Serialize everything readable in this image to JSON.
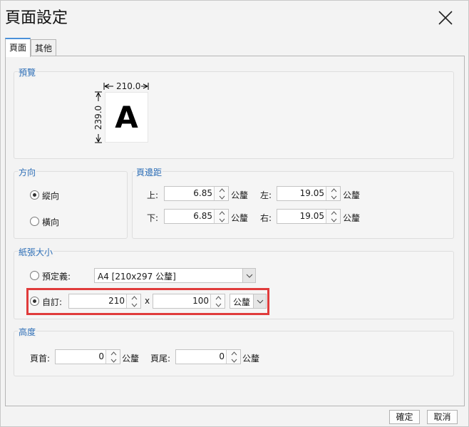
{
  "window": {
    "title": "頁面設定"
  },
  "tabs": [
    {
      "label": "頁面"
    },
    {
      "label": "其他"
    }
  ],
  "preview": {
    "label": "預覽",
    "width": "210.0",
    "height": "239.0",
    "letter": "A"
  },
  "orientation": {
    "label": "方向",
    "portrait": "縱向",
    "landscape": "橫向",
    "selected": "portrait"
  },
  "margins": {
    "label": "頁邊距",
    "top_label": "上:",
    "top": "6.85",
    "left_label": "左:",
    "left": "19.05",
    "bottom_label": "下:",
    "bottom": "6.85",
    "right_label": "右:",
    "right": "19.05",
    "unit": "公釐"
  },
  "paper": {
    "label": "紙張大小",
    "predefined_label": "預定義:",
    "predefined_value": "A4 [210x297 公釐]",
    "custom_label": "自訂:",
    "custom_width": "210",
    "times": "x",
    "custom_height": "100",
    "custom_unit": "公釐",
    "selected": "custom"
  },
  "height_group": {
    "label": "高度",
    "header_label": "頁首:",
    "header_value": "0",
    "footer_label": "頁尾:",
    "footer_value": "0",
    "unit": "公釐"
  },
  "buttons": {
    "ok": "確定",
    "cancel": "取消"
  },
  "colors": {
    "accent": "#2e6fb7",
    "highlight": "#e03b3b"
  }
}
